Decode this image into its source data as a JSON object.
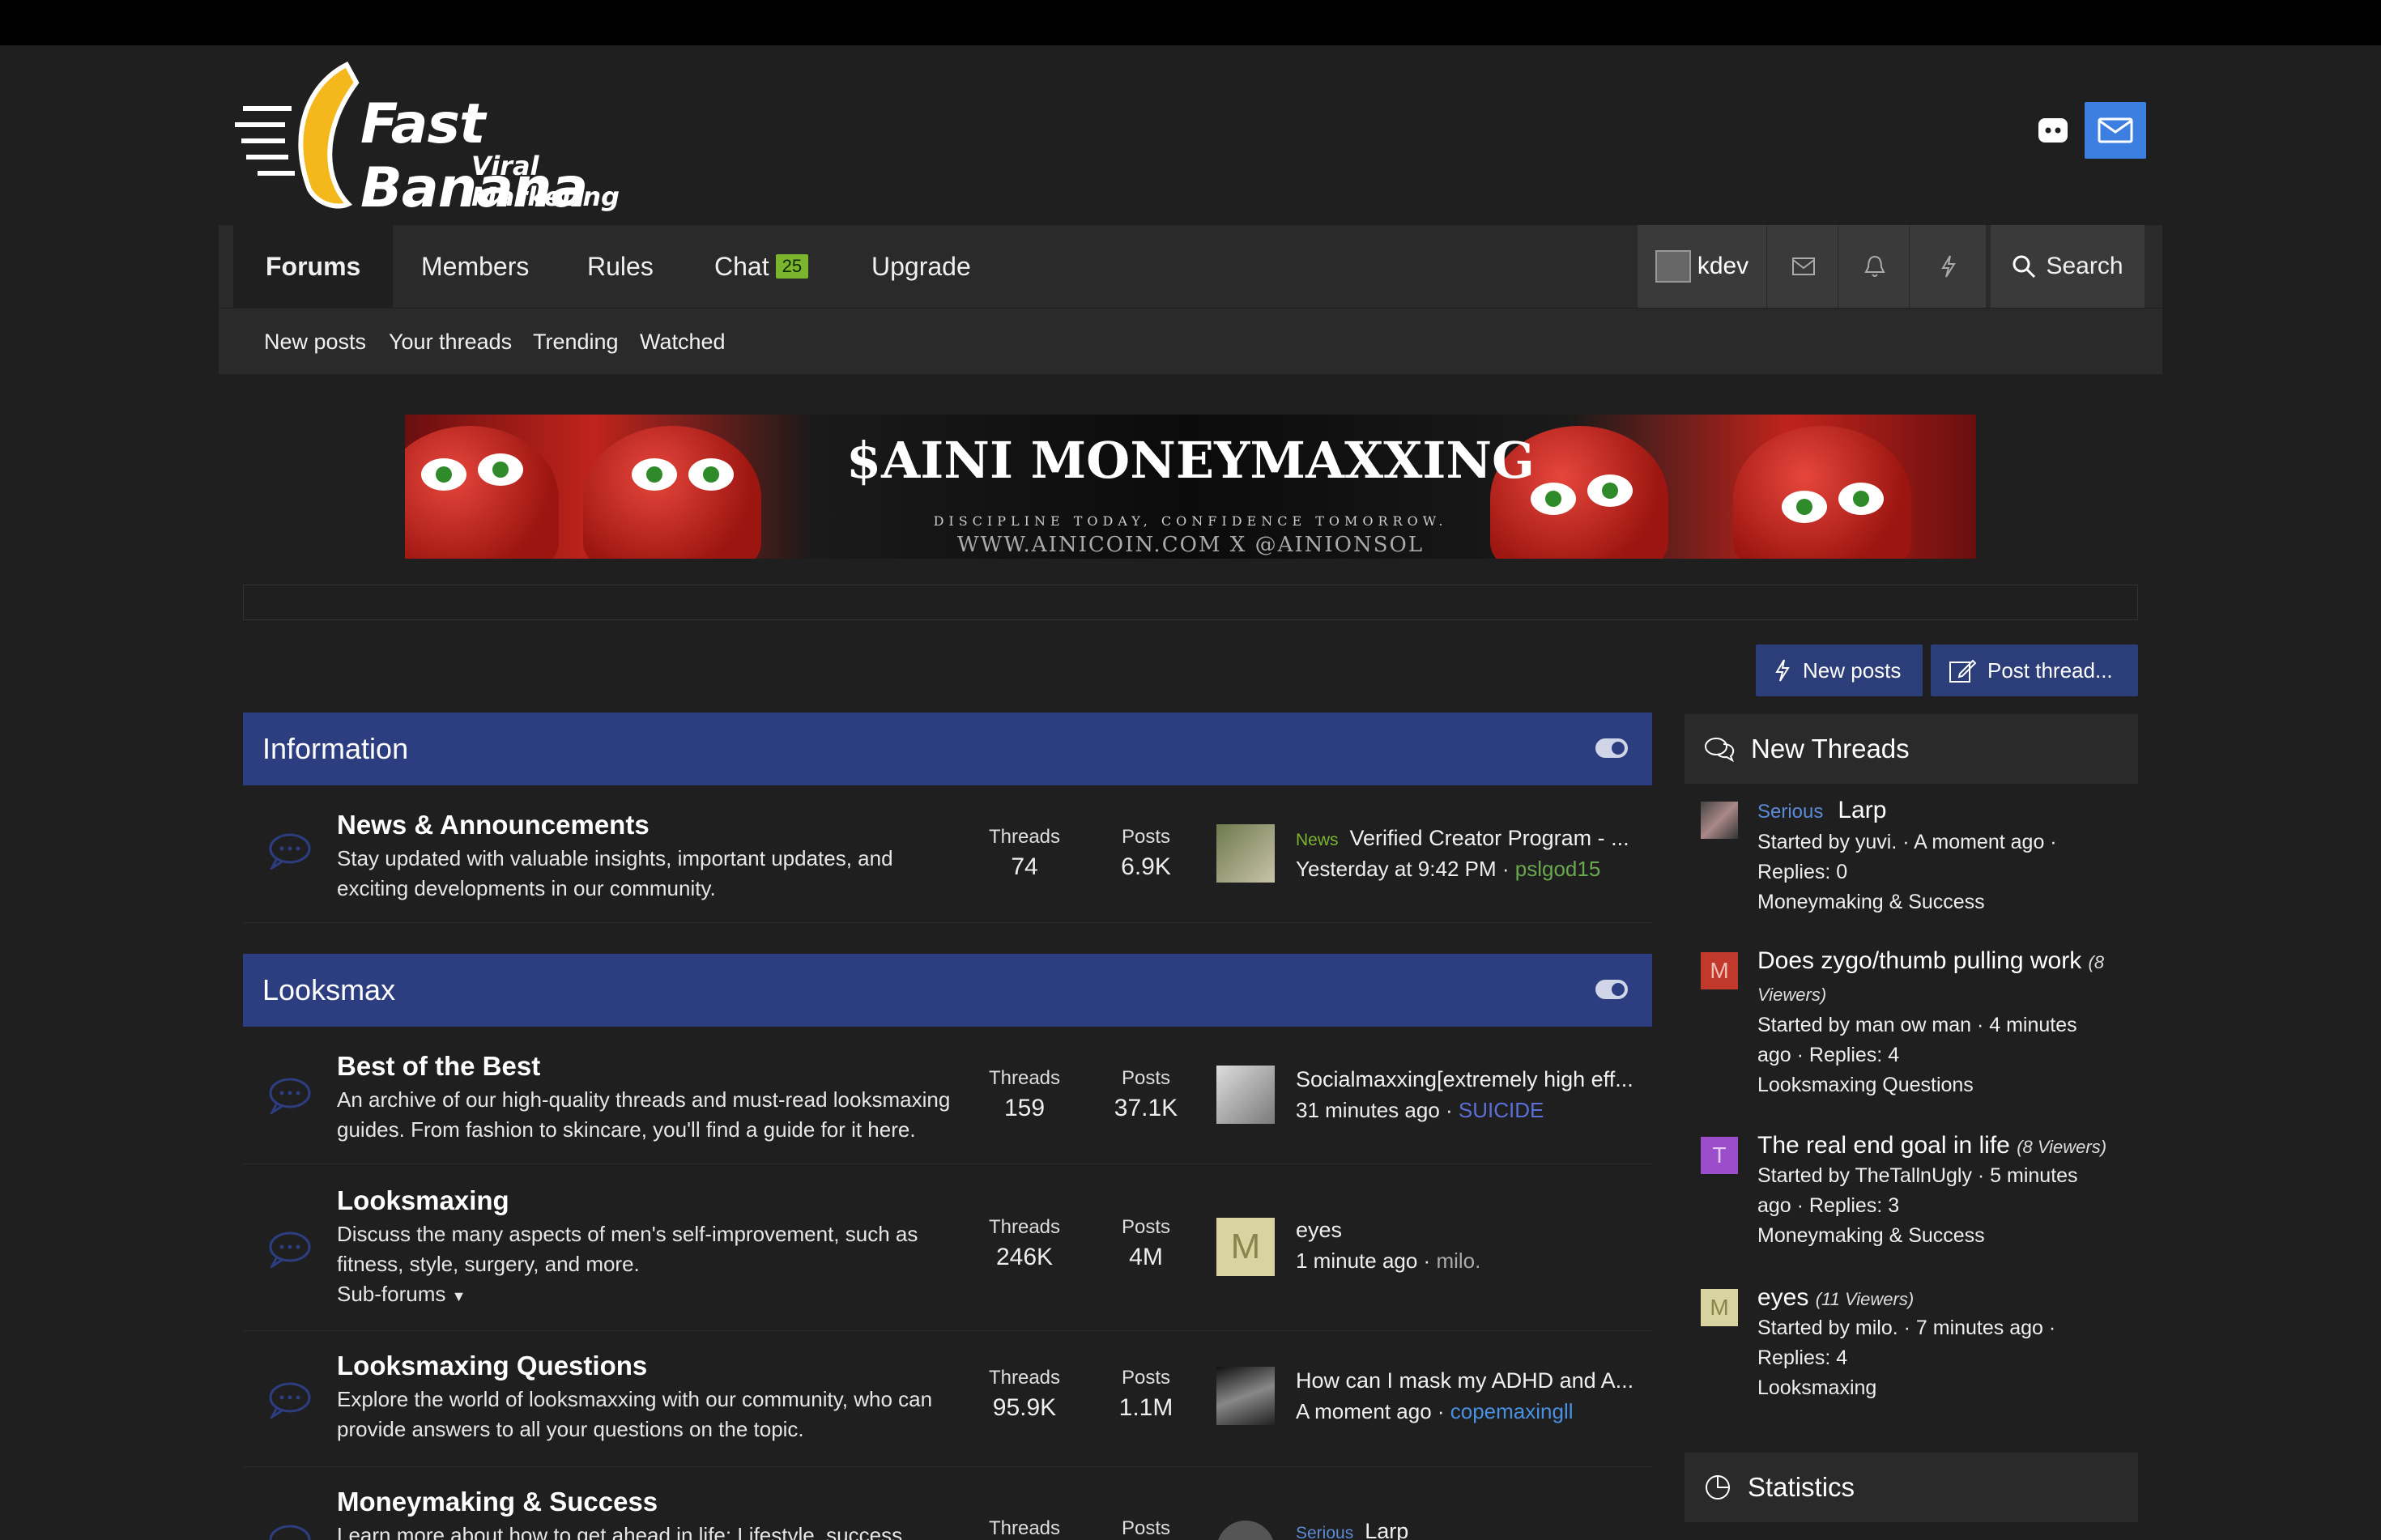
{
  "logo": {
    "name": "Fast Banana",
    "tagline": "Viral Marketing"
  },
  "nav": {
    "items": [
      "Forums",
      "Members",
      "Rules",
      "Chat",
      "Upgrade"
    ],
    "chat_badge": "25",
    "username": "kdev",
    "search_label": "Search"
  },
  "subnav": {
    "items": [
      "New posts",
      "Your threads",
      "Trending",
      "Watched"
    ]
  },
  "banner": {
    "title": "$AINI MONEYMAXXING",
    "subtitle": "DISCIPLINE TODAY, CONFIDENCE TOMORROW.",
    "links": "WWW.AINICOIN.COM  X @AINIONSOL"
  },
  "actions": {
    "new_posts": "New posts",
    "post_thread": "Post thread..."
  },
  "labels": {
    "threads": "Threads",
    "posts": "Posts"
  },
  "categories": [
    {
      "title": "Information",
      "forums": [
        {
          "title": "News & Announcements",
          "desc": "Stay updated with valuable insights, important updates, and exciting developments in our community.",
          "threads": "74",
          "posts": "6.9K",
          "last_tag": "News",
          "last_title": "Verified Creator Program - ...",
          "last_time": "Yesterday at 9:42 PM",
          "last_user": "pslgod15",
          "last_user_color": "#6aa84f"
        }
      ]
    },
    {
      "title": "Looksmax",
      "forums": [
        {
          "title": "Best of the Best",
          "desc": "An archive of our high-quality threads and must-read looksmaxing guides. From fashion to skincare, you'll find a guide for it here.",
          "threads": "159",
          "posts": "37.1K",
          "last_title": "Socialmaxxing[extremely high eff...",
          "last_time": "31 minutes ago",
          "last_user": "SUICIDE",
          "last_user_color": "#5b6fd6"
        },
        {
          "title": "Looksmaxing",
          "desc": "Discuss the many aspects of men's self-improvement, such as fitness, style, surgery, and more.",
          "subforums": "Sub-forums",
          "threads": "246K",
          "posts": "4M",
          "last_avatar_letter": "M",
          "last_title": "eyes",
          "last_time": "1 minute ago",
          "last_user": "milo.",
          "last_user_color": "#aaaaaa"
        },
        {
          "title": "Looksmaxing Questions",
          "desc": "Explore the world of looksmaxxing with our community, who can provide answers to all your questions on the topic.",
          "threads": "95.9K",
          "posts": "1.1M",
          "last_title": "How can I mask my ADHD and A...",
          "last_time": "A moment ago",
          "last_user": "copemaxingll",
          "last_user_color": "#4a90e2"
        },
        {
          "title": "Moneymaking & Success",
          "desc": "Learn more about how to get ahead in life: Lifestyle, success",
          "threads": "",
          "posts": "",
          "last_tag": "Serious",
          "last_title": "Larp"
        }
      ]
    }
  ],
  "sidebar": {
    "new_threads_title": "New Threads",
    "threads": [
      {
        "prefix": "Serious",
        "title": "Larp",
        "viewers": "",
        "meta1": "Started by yuvi. · A moment ago ·",
        "meta2": "Replies: 0",
        "forum": "Moneymaking & Success",
        "avatar_letter": "",
        "avatar_color": "#555555"
      },
      {
        "prefix": "",
        "title": "Does zygo/thumb pulling work",
        "viewers": "(8 Viewers)",
        "meta1": "Started by man ow man · 4 minutes",
        "meta2": "ago · Replies: 4",
        "forum": "Looksmaxing Questions",
        "avatar_letter": "M",
        "avatar_color": "#c0392b"
      },
      {
        "prefix": "",
        "title": "The real end goal in life",
        "viewers": "(8 Viewers)",
        "meta1": "Started by TheTallnUgly · 5 minutes",
        "meta2": "ago · Replies: 3",
        "forum": "Moneymaking & Success",
        "avatar_letter": "T",
        "avatar_color": "#9b4dca"
      },
      {
        "prefix": "",
        "title": "eyes",
        "viewers": "(11 Viewers)",
        "meta1": "Started by milo. · 7 minutes ago ·",
        "meta2": "Replies: 4",
        "forum": "Looksmaxing",
        "avatar_letter": "M",
        "avatar_color": "#d8d3a0"
      }
    ],
    "statistics_title": "Statistics"
  },
  "colors": {
    "accent": "#2d3e80",
    "button": "#2c3e7a",
    "badge": "#7bb42d",
    "mail": "#3d7fe0"
  }
}
